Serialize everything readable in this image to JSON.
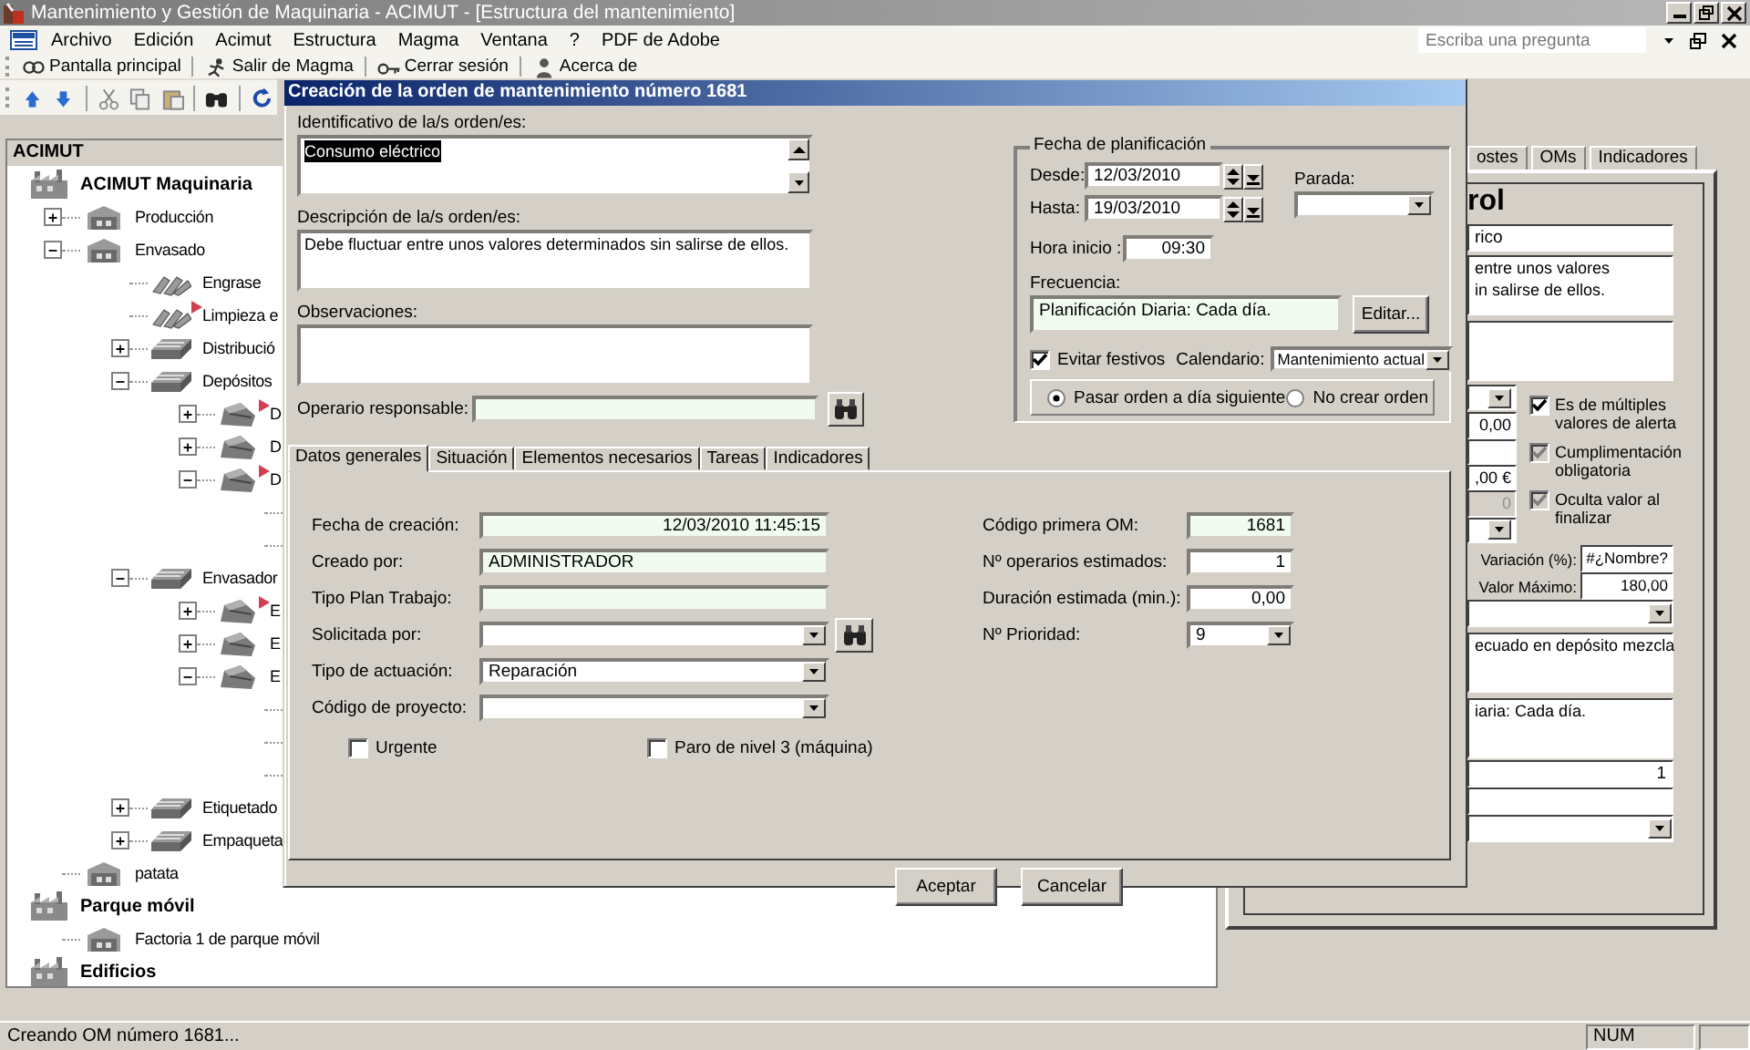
{
  "window": {
    "title": "Mantenimiento y Gestión de Maquinaria - ACIMUT - [Estructura del mantenimiento]"
  },
  "menu": {
    "items": [
      "Archivo",
      "Edición",
      "Acimut",
      "Estructura",
      "Magma",
      "Ventana",
      "?",
      "PDF de Adobe"
    ],
    "help_field": {
      "placeholder": "Escriba una pregunta"
    }
  },
  "toolbar": {
    "buttons": [
      {
        "label": "Pantalla principal",
        "kind": "home"
      },
      {
        "label": "Salir de Magma",
        "kind": "exit"
      },
      {
        "label": "Cerrar sesión",
        "kind": "logout"
      },
      {
        "label": "Acerca de",
        "kind": "about"
      }
    ]
  },
  "tree_panel": {
    "title": "ACIMUT",
    "nodes": [
      {
        "label": "ACIMUT Maquinaria",
        "kind": "site",
        "children": [
          {
            "label": "Producción",
            "kind": "plant",
            "expanded": false
          },
          {
            "label": "Envasado",
            "kind": "plant",
            "expanded": true,
            "children": [
              {
                "label": "Engrase",
                "kind": "task",
                "flagged": false
              },
              {
                "label": "Limpieza e",
                "kind": "task",
                "flagged": true
              },
              {
                "label": "Distribució",
                "kind": "line",
                "expanded": false,
                "flagged": false
              },
              {
                "label": "Depósitos",
                "kind": "line",
                "expanded": true,
                "flagged": false,
                "children": [
                  {
                    "label": "D",
                    "kind": "machine",
                    "expanded": false,
                    "flagged": true
                  },
                  {
                    "label": "D",
                    "kind": "machine",
                    "expanded": false,
                    "flagged": false
                  },
                  {
                    "label": "D",
                    "kind": "machine",
                    "expanded": true,
                    "flagged": true,
                    "children": [
                      {
                        "kind": "covered"
                      },
                      {
                        "kind": "covered"
                      }
                    ]
                  }
                ]
              },
              {
                "label": "Envasador",
                "kind": "line",
                "expanded": true,
                "flagged": false,
                "children": [
                  {
                    "label": "E",
                    "kind": "machine",
                    "expanded": false,
                    "flagged": true
                  },
                  {
                    "label": "E",
                    "kind": "machine",
                    "expanded": false,
                    "flagged": false
                  },
                  {
                    "label": "E",
                    "kind": "machine",
                    "expanded": true,
                    "flagged": false,
                    "children": [
                      {
                        "kind": "covered"
                      },
                      {
                        "kind": "covered"
                      },
                      {
                        "kind": "covered"
                      }
                    ]
                  }
                ]
              },
              {
                "label": "Etiquetado",
                "kind": "line",
                "expanded": false,
                "flagged": false
              },
              {
                "label": "Empaqueta",
                "kind": "line",
                "expanded": false,
                "flagged": false
              }
            ]
          },
          {
            "label": "patata",
            "kind": "plant"
          }
        ]
      },
      {
        "label": "Parque móvil",
        "kind": "site",
        "children": [
          {
            "label": "Factoria 1 de parque móvil",
            "kind": "plant"
          }
        ]
      },
      {
        "label": "Edificios",
        "kind": "site"
      }
    ]
  },
  "detail_panel": {
    "tabs": [
      {
        "label": "ostes",
        "selected": false
      },
      {
        "label": "OMs",
        "selected": false
      },
      {
        "label": "Indicadores",
        "selected": false
      }
    ],
    "heading": "rol",
    "top_fields": [
      {
        "kind": "text",
        "value": "rico"
      },
      {
        "kind": "textarea",
        "lines": [
          "entre unos valores",
          "in salirse de ellos."
        ]
      },
      {
        "kind": "textarea"
      }
    ],
    "small_fields": [
      {
        "kind": "dropdown"
      },
      {
        "kind": "number",
        "value": "0,00"
      },
      {
        "kind": "number"
      },
      {
        "kind": "number",
        "value": ",00 €"
      },
      {
        "kind": "number",
        "value": "0",
        "disabled": true
      },
      {
        "kind": "dropdown"
      }
    ],
    "checkboxes": [
      {
        "label": "Es de múltiples valores de alerta",
        "checked": true,
        "disabled": false
      },
      {
        "label": "Cumplimentación obligatoria",
        "checked": true,
        "disabled": true
      },
      {
        "label": "Oculta valor al finalizar",
        "checked": true,
        "disabled": true
      }
    ],
    "labeled_fields": [
      {
        "label": "Variación (%):",
        "value": "#¿Nombre?"
      },
      {
        "label": "Valor Máximo:",
        "value": "180,00"
      }
    ],
    "bottom_fields": [
      {
        "kind": "dropdown"
      },
      {
        "kind": "textarea",
        "lines": [
          "ecuado en depósito mezcla"
        ]
      },
      {
        "kind": "textarea",
        "lines": [
          "iaria: Cada día."
        ]
      },
      {
        "kind": "number",
        "value": "1"
      },
      {
        "kind": "text"
      },
      {
        "kind": "dropdown"
      }
    ]
  },
  "dialog": {
    "title": "Creación de la orden de mantenimiento número 1681",
    "identificativo": {
      "label": "Identificativo de la/s orden/es:",
      "value": "Consumo eléctrico",
      "value_selected": true
    },
    "descripcion": {
      "label": "Descripción de la/s orden/es:",
      "value": "Debe fluctuar entre unos valores determinados sin salirse de ellos."
    },
    "observaciones": {
      "label": "Observaciones:"
    },
    "operario": {
      "label": "Operario responsable:"
    },
    "planning": {
      "title": "Fecha de planificación",
      "desde": {
        "label": "Desde:",
        "value": "12/03/2010"
      },
      "hasta": {
        "label": "Hasta:",
        "value": "19/03/2010"
      },
      "parada": {
        "label": "Parada:"
      },
      "hora": {
        "label": "Hora inicio :",
        "value": "09:30"
      },
      "frecuencia": {
        "label": "Frecuencia:",
        "value": "Planificación Diaria: Cada día."
      },
      "edit_button": "Editar...",
      "evitar_festivos": {
        "label": "Evitar festivos",
        "checked": true
      },
      "calendario": {
        "label": "Calendario:",
        "value": "Mantenimiento actual"
      },
      "options": [
        {
          "label": "Pasar orden a día siguiente",
          "selected": true
        },
        {
          "label": "No crear orden",
          "selected": false
        }
      ]
    },
    "tabs": [
      {
        "label": "Datos generales",
        "selected": true
      },
      {
        "label": "Situación",
        "selected": false
      },
      {
        "label": "Elementos necesarios",
        "selected": false
      },
      {
        "label": "Tareas",
        "selected": false
      },
      {
        "label": "Indicadores",
        "selected": false
      }
    ],
    "left_fields": [
      {
        "label": "Fecha de creación:",
        "kind": "date",
        "value": "12/03/2010 11:45:15",
        "readonly": true
      },
      {
        "label": "Creado por:",
        "kind": "text",
        "value": "ADMINISTRADOR",
        "readonly": true
      },
      {
        "label": "Tipo Plan Trabajo:",
        "kind": "text",
        "readonly": true
      },
      {
        "label": "Solicitada por:",
        "kind": "dropdown",
        "readonly": false,
        "search_button": true
      },
      {
        "label": "Tipo de actuación:",
        "kind": "dropdown",
        "value": "Reparación",
        "readonly": false
      },
      {
        "label": "Código de proyecto:",
        "kind": "dropdown",
        "readonly": false
      }
    ],
    "right_fields": [
      {
        "label": "Código primera OM:",
        "kind": "number",
        "value": "1681",
        "readonly": true
      },
      {
        "label": "Nº operarios estimados:",
        "kind": "number",
        "value": "1",
        "readonly": false
      },
      {
        "label": "Duración estimada (min.):",
        "kind": "number",
        "value": "0,00",
        "readonly": false
      },
      {
        "label": "Nº Prioridad:",
        "kind": "number-dropdown",
        "value": "9",
        "readonly": false
      }
    ],
    "checkboxes": [
      {
        "label": "Urgente",
        "checked": false
      },
      {
        "label": "Paro de nivel 3 (máquina)",
        "checked": false
      }
    ],
    "buttons": [
      "Aceptar",
      "Cancelar"
    ]
  },
  "status_bar": {
    "message": "Creando OM número 1681...",
    "indicators": [
      "NUM"
    ]
  }
}
